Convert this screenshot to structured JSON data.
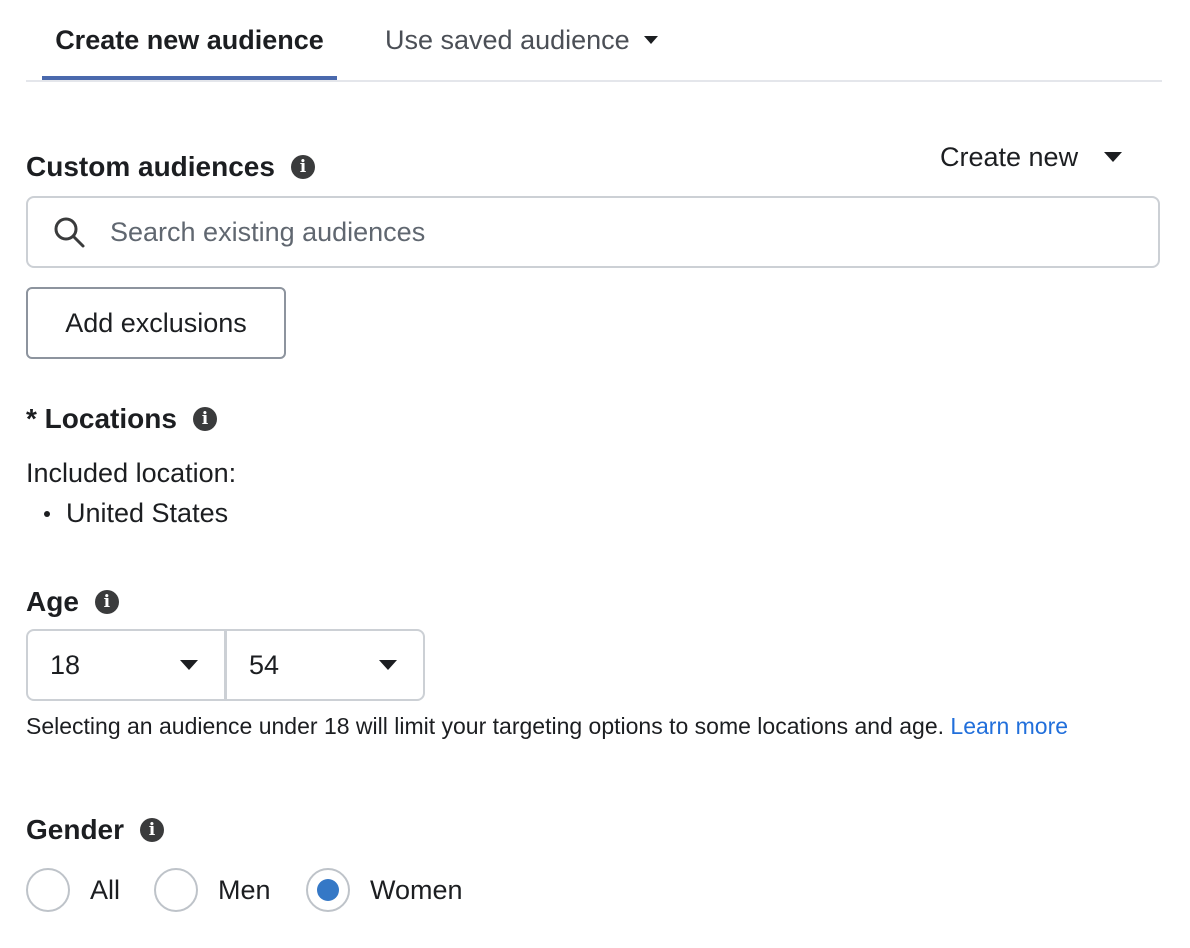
{
  "tabs": {
    "create_new": "Create new audience",
    "use_saved": "Use saved audience"
  },
  "custom_audiences": {
    "title": "Custom audiences",
    "create_new_label": "Create new",
    "search_placeholder": "Search existing audiences",
    "add_exclusions_label": "Add exclusions"
  },
  "locations": {
    "title": "* Locations",
    "included_label": "Included location:",
    "items": [
      "United States"
    ]
  },
  "age": {
    "title": "Age",
    "min": "18",
    "max": "54",
    "helper_text": "Selecting an audience under 18 will limit your targeting options to some locations and age.",
    "learn_more": "Learn more"
  },
  "gender": {
    "title": "Gender",
    "options": [
      "All",
      "Men",
      "Women"
    ],
    "selected": "Women"
  },
  "colors": {
    "accent": "#4a69ad",
    "link": "#216fdb",
    "radio_selected": "#3578c6"
  },
  "icons": {
    "info": "info-icon",
    "search": "search-icon",
    "dropdown": "caret-down-icon"
  }
}
